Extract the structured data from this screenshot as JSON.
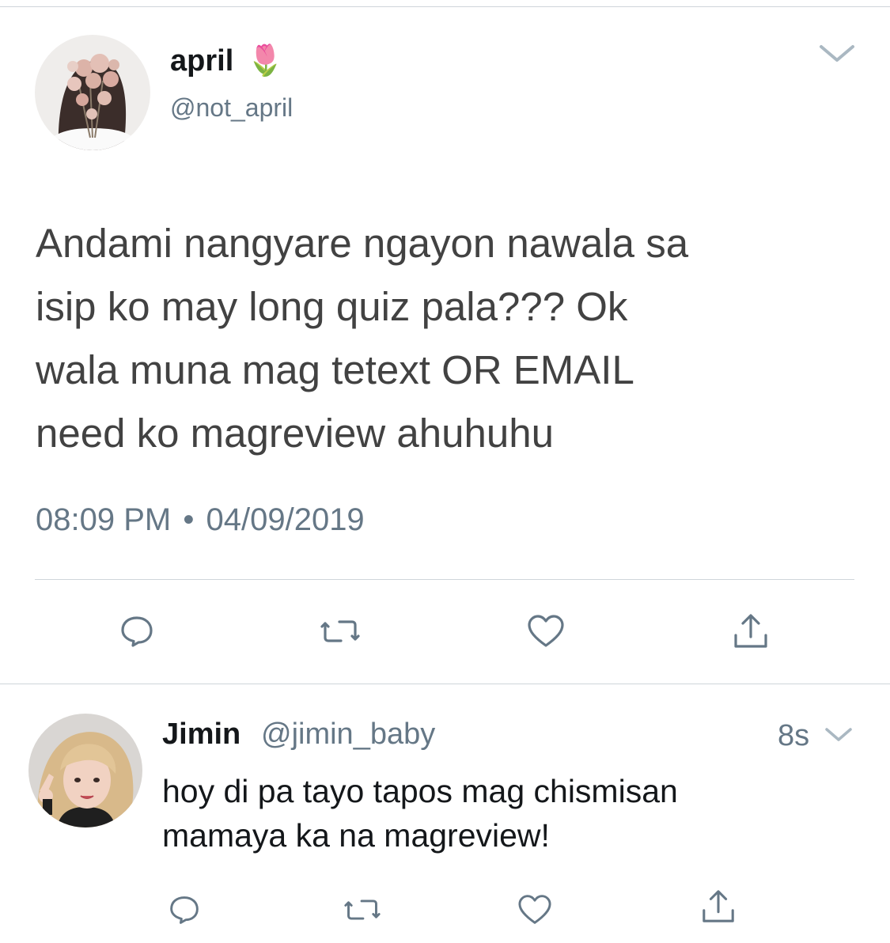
{
  "main_tweet": {
    "author_name": "april",
    "author_emoji": "🌷",
    "author_handle": "@not_april",
    "text": "Andami nangyare ngayon nawala sa\nisip ko may long quiz pala??? Ok\nwala muna mag tetext OR EMAIL\nneed ko magreview ahuhuhu",
    "time": "08:09 PM",
    "separator": "•",
    "date": "04/09/2019",
    "avatar_icon": "profile-photo-flowers",
    "menu_icon": "chevron-down-icon",
    "actions": [
      "reply-icon",
      "retweet-icon",
      "like-icon",
      "share-icon"
    ]
  },
  "reply_tweet": {
    "author_name": "Jimin",
    "author_handle": "@jimin_baby",
    "age": "8s",
    "text": "hoy di pa tayo tapos mag chismisan\nmamaya ka na magreview!",
    "avatar_icon": "profile-photo-blonde",
    "menu_icon": "chevron-down-icon",
    "actions": [
      "reply-icon",
      "retweet-icon",
      "like-icon",
      "share-icon"
    ]
  },
  "colors": {
    "text_primary": "#14171a",
    "text_secondary": "#657786",
    "icon_gray": "#657786",
    "divider": "#cfd5da"
  }
}
